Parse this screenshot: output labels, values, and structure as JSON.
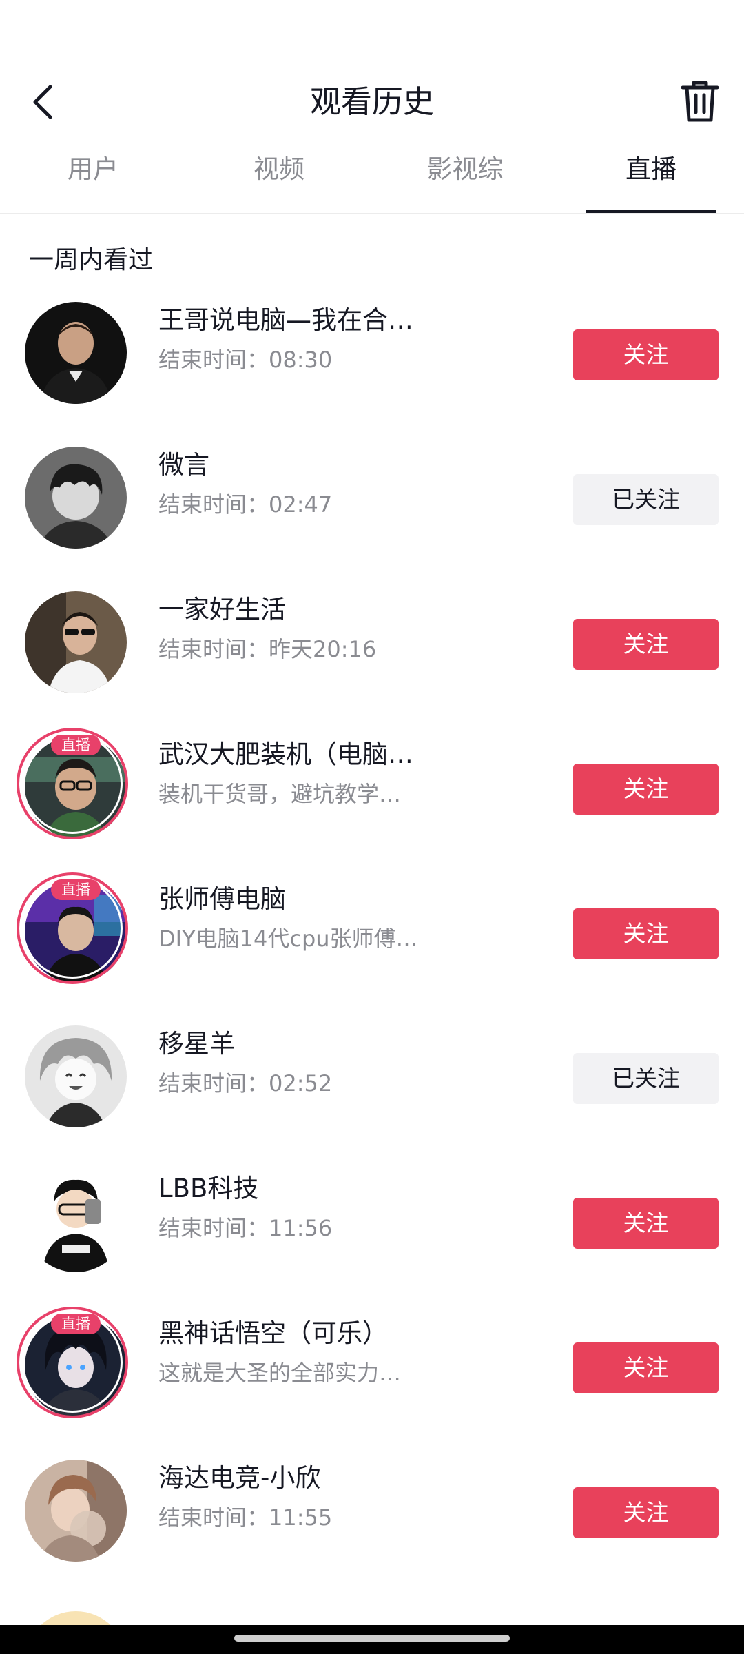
{
  "header": {
    "title": "观看历史"
  },
  "tabs": [
    {
      "label": "用户",
      "active": false
    },
    {
      "label": "视频",
      "active": false
    },
    {
      "label": "影视综",
      "active": false
    },
    {
      "label": "直播",
      "active": true
    }
  ],
  "section": {
    "title": "一周内看过"
  },
  "items": [
    {
      "name": "王哥说电脑—我在合…",
      "sub": "结束时间：08:30",
      "button": "关注",
      "following": false,
      "live": false
    },
    {
      "name": "微言",
      "sub": "结束时间：02:47",
      "button": "已关注",
      "following": true,
      "live": false
    },
    {
      "name": "一家好生活",
      "sub": "结束时间：昨天20:16",
      "button": "关注",
      "following": false,
      "live": false
    },
    {
      "name": "武汉大肥装机（电脑…",
      "sub": "装机干货哥，避坑教学…",
      "button": "关注",
      "following": false,
      "live": true,
      "live_label": "直播"
    },
    {
      "name": "张师傅电脑",
      "sub": "DIY电脑14代cpu张师傅…",
      "button": "关注",
      "following": false,
      "live": true,
      "live_label": "直播"
    },
    {
      "name": "移星羊",
      "sub": "结束时间：02:52",
      "button": "已关注",
      "following": true,
      "live": false
    },
    {
      "name": "LBB科技",
      "sub": "结束时间：11:56",
      "button": "关注",
      "following": false,
      "live": false
    },
    {
      "name": "黑神话悟空（可乐）",
      "sub": "这就是大圣的全部实力…",
      "button": "关注",
      "following": false,
      "live": true,
      "live_label": "直播"
    },
    {
      "name": "海达电竞-小欣",
      "sub": "结束时间：11:55",
      "button": "关注",
      "following": false,
      "live": false
    }
  ],
  "colors": {
    "accent": "#e8415b",
    "live_ring": "#e8416a",
    "followed_bg": "#f2f2f4"
  }
}
